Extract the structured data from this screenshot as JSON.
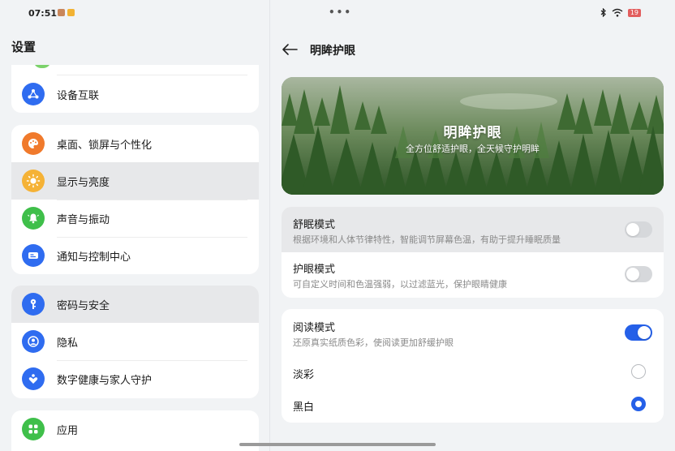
{
  "status_bar": {
    "time": "07:51",
    "battery": "19",
    "colors": {
      "battery": "#e25d5d"
    }
  },
  "left": {
    "title": "设置",
    "card1": [
      {
        "label": "设备互联",
        "icon": "devices-icon",
        "color": "#2f6cf0"
      }
    ],
    "card2": [
      {
        "label": "桌面、锁屏与个性化",
        "icon": "palette-icon",
        "color": "#f07a2c"
      },
      {
        "label": "显示与亮度",
        "icon": "sun-icon",
        "color": "#f5a623"
      },
      {
        "label": "声音与振动",
        "icon": "bell-icon",
        "color": "#3fbf4a"
      },
      {
        "label": "通知与控制中心",
        "icon": "notification-icon",
        "color": "#2f6cf0"
      }
    ],
    "card3": [
      {
        "label": "密码与安全",
        "icon": "key-icon",
        "color": "#2f6cf0"
      },
      {
        "label": "隐私",
        "icon": "privacy-icon",
        "color": "#2f6cf0"
      },
      {
        "label": "数字健康与家人守护",
        "icon": "heart-icon",
        "color": "#2f6cf0"
      }
    ],
    "card4": [
      {
        "label": "应用",
        "icon": "apps-icon",
        "color": "#3fbf4a"
      }
    ]
  },
  "right": {
    "title": "明眸护眼",
    "banner": {
      "title": "明眸护眼",
      "subtitle": "全方位舒适护眼，全天候守护明眸"
    },
    "sleep_mode": {
      "title": "舒眠模式",
      "desc": "根据环境和人体节律特性，智能调节屏幕色温，有助于提升睡眠质量",
      "enabled": false
    },
    "eye_mode": {
      "title": "护眼模式",
      "desc": "可自定义时间和色温强弱，以过滤蓝光，保护眼睛健康",
      "enabled": false
    },
    "reading_mode": {
      "title": "阅读模式",
      "desc": "还原真实纸质色彩，使阅读更加舒缓护眼",
      "enabled": true,
      "options": [
        {
          "label": "淡彩",
          "selected": false
        },
        {
          "label": "黑白",
          "selected": true
        }
      ]
    },
    "colors": {
      "accent": "#2560e8"
    }
  }
}
